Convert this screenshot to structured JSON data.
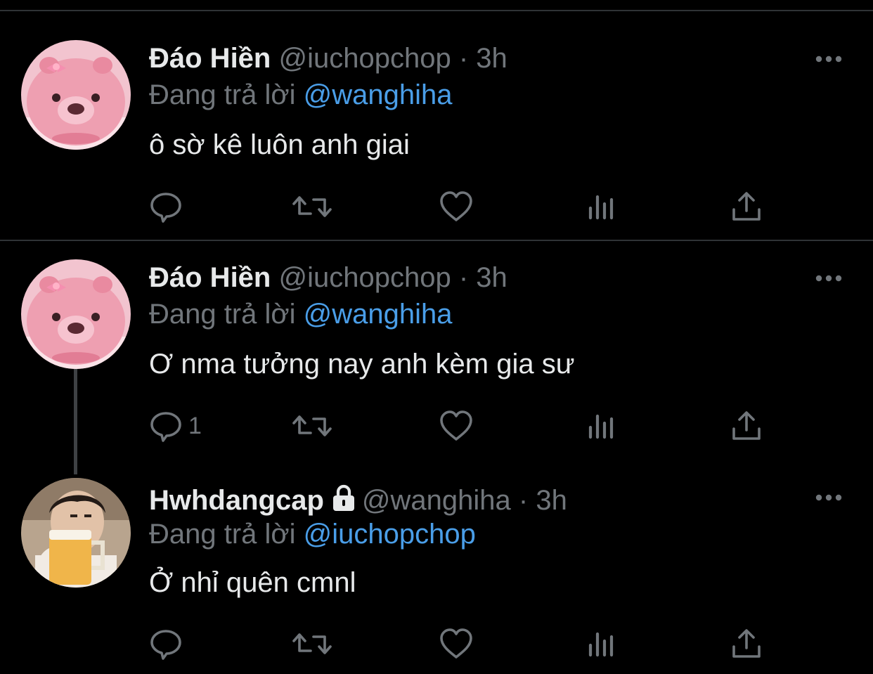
{
  "tweets": [
    {
      "name": "Đáo Hiền",
      "handle": "@iuchopchop",
      "separator": "·",
      "time": "3h",
      "reply_prefix": "Đang trả lời",
      "reply_to": "@wanghiha",
      "text": "ô sờ kê luôn anh giai",
      "avatar": "pink-beaver-avatar",
      "reply_count": "",
      "locked": false
    },
    {
      "name": "Đáo Hiền",
      "handle": "@iuchopchop",
      "separator": "·",
      "time": "3h",
      "reply_prefix": "Đang trả lời",
      "reply_to": "@wanghiha",
      "text": "Ơ nma tưởng nay anh kèm gia sư",
      "avatar": "pink-beaver-avatar",
      "reply_count": "1",
      "locked": false
    },
    {
      "name": "Hwhdangcap",
      "handle": "@wanghiha",
      "separator": "·",
      "time": "3h",
      "reply_prefix": "Đang trả lời",
      "reply_to": "@iuchopchop",
      "text": "Ở nhỉ quên cmnl",
      "avatar": "man-with-beer-avatar",
      "reply_count": "",
      "locked": true
    }
  ],
  "icons": {
    "reply": "reply-icon",
    "retweet": "retweet-icon",
    "like": "like-icon",
    "views": "views-icon",
    "share": "share-icon",
    "more": "more-icon",
    "lock": "lock-icon"
  },
  "colors": {
    "background": "#000000",
    "text": "#e7e9ea",
    "muted": "#71767b",
    "mention": "#4a9ee8",
    "divider": "#2f3336"
  }
}
